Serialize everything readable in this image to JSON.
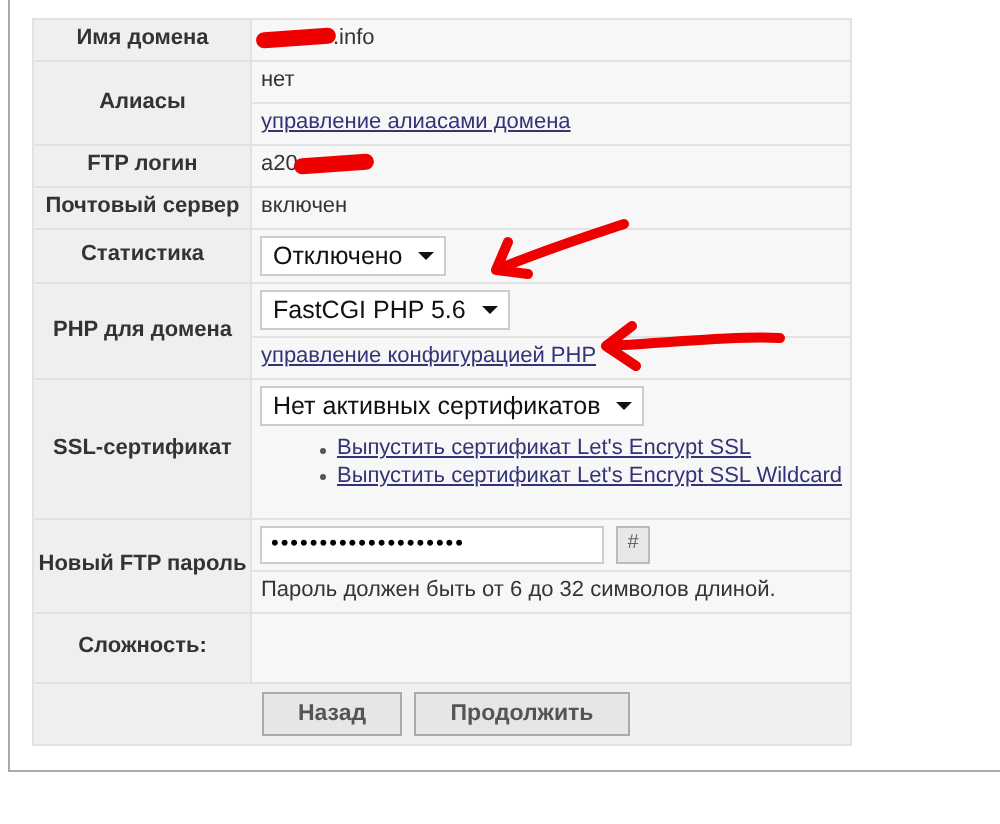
{
  "rows": [
    {
      "label": "Имя домена",
      "lines": [
        {
          "kind": "text",
          "text": ".info",
          "redacted_before": true
        }
      ]
    },
    {
      "label": "Алиасы",
      "lines": [
        {
          "kind": "text",
          "text": "нет"
        },
        {
          "kind": "link",
          "text": "управление алиасами домена"
        }
      ]
    },
    {
      "label": "FTP логин",
      "lines": [
        {
          "kind": "text",
          "text": "a20",
          "redacted_after": true
        }
      ]
    },
    {
      "label": "Почтовый сервер",
      "lines": [
        {
          "kind": "text",
          "text": "включен"
        }
      ]
    },
    {
      "label": "Статистика",
      "lines": [
        {
          "kind": "select",
          "text": "Отключено"
        }
      ]
    },
    {
      "label": "PHP для домена",
      "lines": [
        {
          "kind": "select",
          "text": "FastCGI PHP 5.6"
        },
        {
          "kind": "link",
          "text": "управление конфигурацией PHP"
        }
      ]
    },
    {
      "label": "SSL-сертификат",
      "lines": [
        {
          "kind": "select_links",
          "text": "Нет активных сертификатов",
          "links": [
            "Выпустить сертификат Let's Encrypt SSL",
            "Выпустить сертификат Let's Encrypt SSL Wildcard"
          ]
        }
      ]
    },
    {
      "label": "Новый FTP пароль",
      "lines": [
        {
          "kind": "password",
          "value": "••••••••••••••••••••",
          "button": "#"
        },
        {
          "kind": "hint",
          "text": "Пароль должен быть от 6 до 32 символов длиной."
        }
      ]
    },
    {
      "label": "Сложность:",
      "lines": [
        {
          "kind": "empty"
        }
      ]
    }
  ],
  "buttons": [
    "Назад",
    "Продолжить"
  ]
}
